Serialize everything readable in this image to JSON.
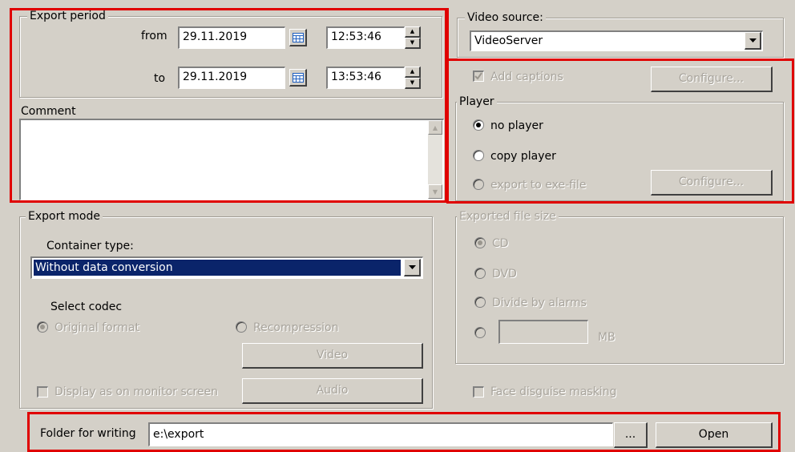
{
  "export_period": {
    "legend": "Export period",
    "from_label": "from",
    "from_date": "29.11.2019",
    "from_time": "12:53:46",
    "to_label": "to",
    "to_date": "29.11.2019",
    "to_time": "13:53:46"
  },
  "comment": {
    "label": "Comment",
    "value": ""
  },
  "video_source": {
    "legend": "Video source:",
    "value": "VideoServer"
  },
  "captions": {
    "label": "Add captions",
    "checked": true,
    "enabled": false,
    "configure_label": "Configure..."
  },
  "player": {
    "legend": "Player",
    "options": [
      "no player",
      "copy player",
      "export to exe-file"
    ],
    "selected": "no player",
    "configure_label": "Configure..."
  },
  "export_mode": {
    "legend": "Export mode",
    "container_label": "Container type:",
    "container_value": "Without data conversion",
    "codec_label": "Select codec",
    "codec_options": [
      "Original format",
      "Recompression"
    ],
    "codec_selected": "Original format",
    "video_button": "Video",
    "audio_button": "Audio",
    "display_monitor_label": "Display as on monitor screen"
  },
  "file_size": {
    "legend": "Exported file size",
    "options": [
      "CD",
      "DVD",
      "Divide by alarms"
    ],
    "selected": "CD",
    "custom_value": "",
    "unit": "MB"
  },
  "face_mask": {
    "label": "Face disguise masking"
  },
  "folder": {
    "label": "Folder for writing",
    "value": "e:\\export",
    "browse_label": "...",
    "open_label": "Open"
  },
  "colors": {
    "highlight": "#e00000",
    "selection": "#0a246a",
    "panel": "#d4d0c8"
  }
}
